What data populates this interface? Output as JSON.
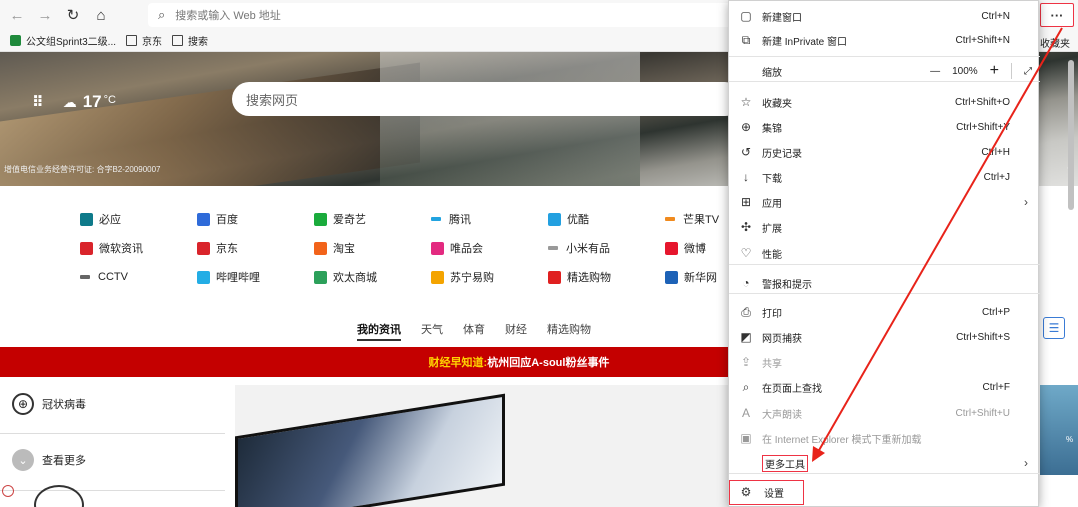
{
  "toolbar": {
    "address_placeholder": "搜索或输入 Web 地址",
    "more_label": "···"
  },
  "bookmarks": {
    "items": [
      "公文组Sprint3二级...",
      "京东",
      "搜索"
    ],
    "right_label": "收藏夹"
  },
  "hero": {
    "temperature": "17",
    "temp_unit": "°C",
    "search_placeholder": "搜索网页",
    "license": "增值电信业务经营许可证: 合字B2-20090007",
    "edge_text": "?"
  },
  "quick_links": [
    {
      "label": "必应",
      "color": "#0e7a8a"
    },
    {
      "label": "百度",
      "color": "#2f6bd9"
    },
    {
      "label": "爱奇艺",
      "color": "#1aab3c"
    },
    {
      "label": "腾讯",
      "color": "#22a3e0",
      "small": true
    },
    {
      "label": "优酷",
      "color": "#23a0e0"
    },
    {
      "label": "芒果TV",
      "color": "#f08a1e",
      "small": true
    },
    {
      "label": "微软资讯",
      "color": "#d9242b"
    },
    {
      "label": "京东",
      "color": "#d9242b"
    },
    {
      "label": "淘宝",
      "color": "#f2631a"
    },
    {
      "label": "唯品会",
      "color": "#e32a80"
    },
    {
      "label": "小米有品",
      "color": "#999999",
      "small": true
    },
    {
      "label": "微博",
      "color": "#e6162d"
    },
    {
      "label": "CCTV",
      "color": "#666666",
      "small": true
    },
    {
      "label": "哔哩哔哩",
      "color": "#23ade5"
    },
    {
      "label": "欢太商城",
      "color": "#2ca05a"
    },
    {
      "label": "苏宁易购",
      "color": "#f4a400"
    },
    {
      "label": "精选购物",
      "color": "#e02020"
    },
    {
      "label": "新华网",
      "color": "#1d62b7"
    }
  ],
  "news_tabs": [
    "我的资讯",
    "天气",
    "体育",
    "财经",
    "精选购物"
  ],
  "headline": {
    "prefix": "财经早知道:",
    "text": " 杭州回应A-soul粉丝事件"
  },
  "left_col": {
    "covid": "冠状病毒",
    "see_more": "查看更多"
  },
  "right_ad": {
    "text": "%"
  },
  "menu": {
    "items": [
      {
        "id": "new-window",
        "icon": "▢",
        "label": "新建窗口",
        "shortcut": "Ctrl+N"
      },
      {
        "id": "new-inprivate",
        "icon": "⧉",
        "label": "新建 InPrivate 窗口",
        "shortcut": "Ctrl+Shift+N"
      },
      {
        "id": "favorites",
        "icon": "☆",
        "label": "收藏夹",
        "shortcut": "Ctrl+Shift+O"
      },
      {
        "id": "collections",
        "icon": "⊕",
        "label": "集锦",
        "shortcut": "Ctrl+Shift+Y"
      },
      {
        "id": "history",
        "icon": "↺",
        "label": "历史记录",
        "shortcut": "Ctrl+H"
      },
      {
        "id": "downloads",
        "icon": "↓",
        "label": "下载",
        "shortcut": "Ctrl+J"
      },
      {
        "id": "apps",
        "icon": "⊞",
        "label": "应用",
        "arrow": "›"
      },
      {
        "id": "extensions",
        "icon": "✣",
        "label": "扩展"
      },
      {
        "id": "performance",
        "icon": "♡",
        "label": "性能"
      },
      {
        "id": "alerts",
        "icon": "◔",
        "label": "警报和提示"
      },
      {
        "id": "print",
        "icon": "⎙",
        "label": "打印",
        "shortcut": "Ctrl+P"
      },
      {
        "id": "web-capture",
        "icon": "◩",
        "label": "网页捕获",
        "shortcut": "Ctrl+Shift+S"
      },
      {
        "id": "share",
        "icon": "⇪",
        "label": "共享",
        "disabled": true
      },
      {
        "id": "find",
        "icon": "⌕",
        "label": "在页面上查找",
        "shortcut": "Ctrl+F"
      },
      {
        "id": "read-aloud",
        "icon": "A",
        "label": "大声朗读",
        "shortcut": "Ctrl+Shift+U",
        "disabled": true
      },
      {
        "id": "ie-mode",
        "icon": "▣",
        "label": "在 Internet Explorer 模式下重新加载",
        "disabled": true
      },
      {
        "id": "more-tools",
        "icon": "",
        "label": "更多工具",
        "arrow": "›",
        "highlighted": true
      },
      {
        "id": "settings",
        "icon": "⚙",
        "label": "设置",
        "highlighted": true
      }
    ],
    "zoom": {
      "label": "缩放",
      "minus": "—",
      "value": "100%",
      "plus": "+",
      "fullscreen": "⤢"
    }
  },
  "colors": {
    "accent_red": "#e34",
    "headline_bg": "#c40000"
  }
}
